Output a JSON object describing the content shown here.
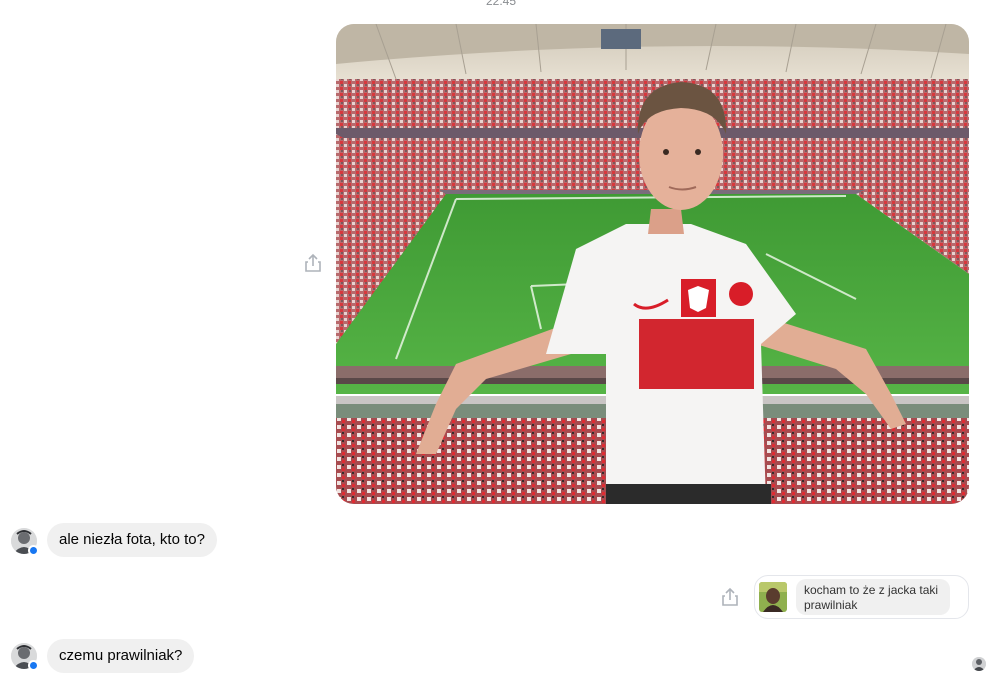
{
  "conversation": {
    "timestamp": "22:45",
    "messages": [
      {
        "sender": "me",
        "type": "photo",
        "alt": ""
      },
      {
        "sender": "contact",
        "type": "text",
        "text": "ale niezła fota, kto to?"
      },
      {
        "sender": "me",
        "type": "reply",
        "text": "kocham to że z jacka taki prawilniak"
      },
      {
        "sender": "contact",
        "type": "text",
        "text": "czemu prawilniak?"
      }
    ]
  },
  "icons": {
    "share": "share-icon",
    "verified_badge": "messenger-badge-icon"
  },
  "colors": {
    "bubble_incoming": "#f0f0f0",
    "badge": "#1877f2",
    "muted_text": "#8a8d91"
  }
}
